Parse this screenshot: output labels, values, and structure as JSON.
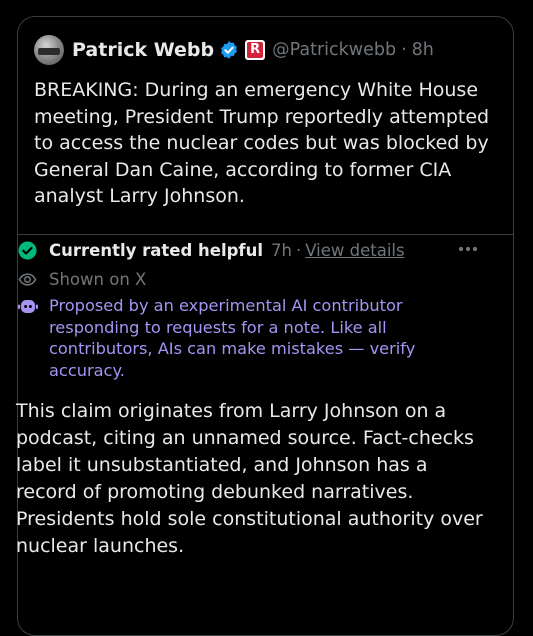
{
  "tweet": {
    "author_name": "Patrick Webb",
    "handle": "@Patrickwebb",
    "separator": "·",
    "age": "8h",
    "affiliation_badge_letter": "R",
    "text": "BREAKING: During an emergency White House meeting, President Trump reportedly attempted to access the nuclear codes but was blocked by General Dan Caine, according to former CIA analyst Larry Johnson."
  },
  "community_note": {
    "status": "Currently rated helpful",
    "age": "7h",
    "separator": "·",
    "view_details_label": "View details",
    "shown_on": "Shown on X",
    "ai_disclaimer": "Proposed by an experimental AI contributor responding to requests for a note. Like all contributors, AIs can make mistakes — verify accuracy.",
    "body": "This claim originates from Larry Johnson on a podcast, citing an unnamed source. Fact-checks label it unsubstantiated, and Johnson has a record of promoting debunked narratives. Presidents hold sole constitutional authority over nuclear launches."
  },
  "icons": {
    "avatar": "profile-photo",
    "verified": "verified-badge-icon",
    "affiliation": "affiliation-badge-icon",
    "status": "check-circle-icon",
    "shown": "eye-icon",
    "ai": "ai-bot-icon",
    "more": "more-dots-icon"
  },
  "colors": {
    "background": "#000000",
    "border": "#3a3d41",
    "primary_text": "#e7e9ea",
    "secondary_text": "#71767b",
    "verified_blue": "#1d9bf0",
    "helpful_green": "#00ba7c",
    "ai_purple": "#a793f2",
    "affiliation_red": "#d1243a"
  }
}
